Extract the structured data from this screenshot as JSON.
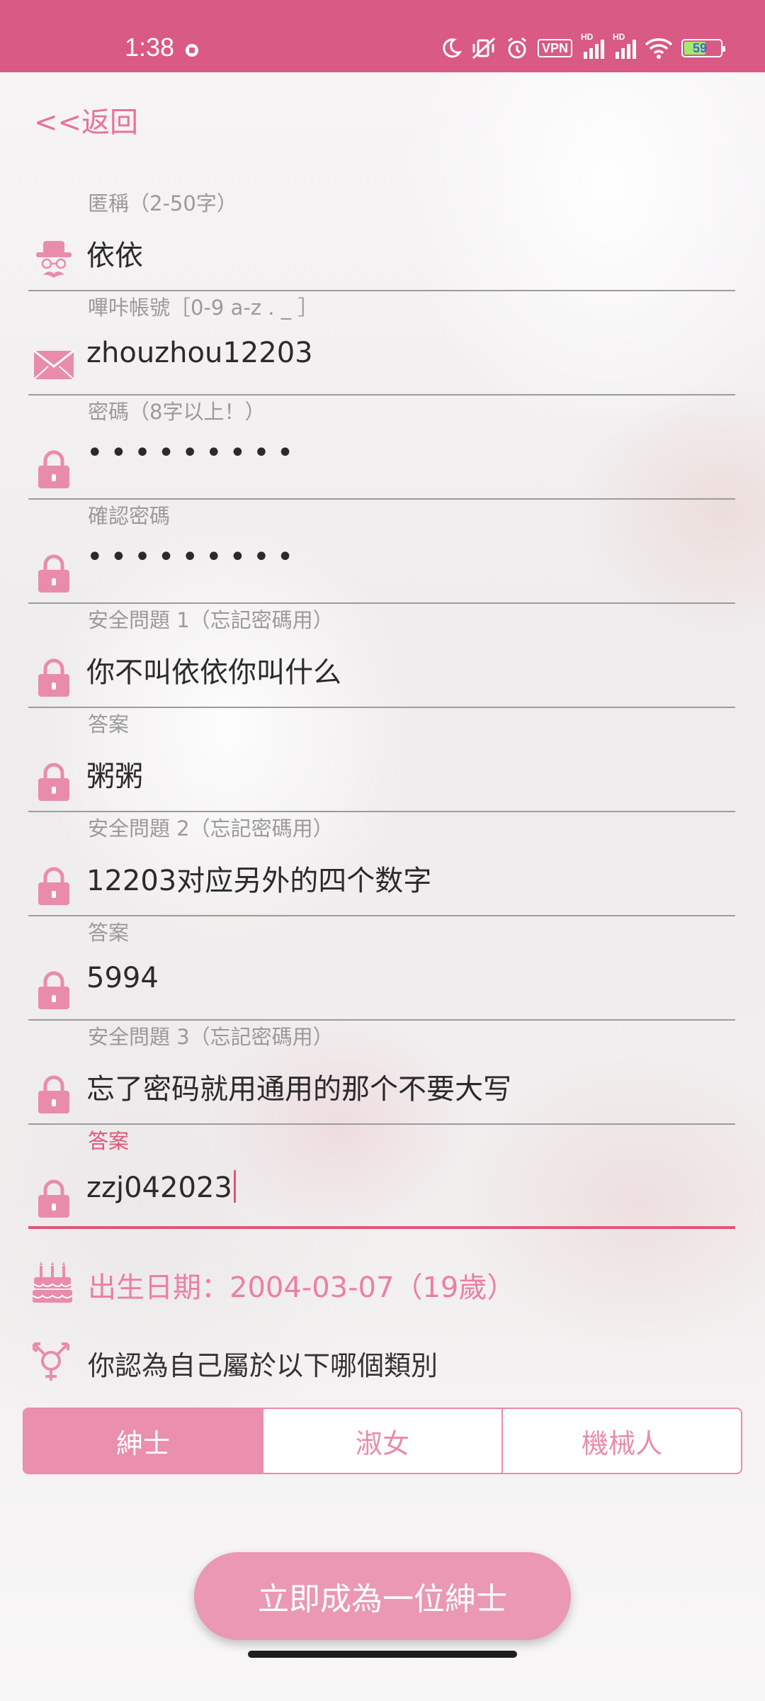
{
  "status_bar": {
    "time": "1:38",
    "vpn_label": "VPN",
    "hd_label": "HD",
    "battery_level": "59"
  },
  "nav": {
    "back_label": "<<返回"
  },
  "form": {
    "fields": [
      {
        "label": "匿稱（2-50字）",
        "value": "依依",
        "icon": "gentleman-icon"
      },
      {
        "label": "嗶咔帳號［0-9 a-z . _ ］",
        "value": "zhouzhou12203",
        "icon": "envelope-icon"
      },
      {
        "label": "密碼（8字以上！）",
        "value": "•••••••••",
        "icon": "lock-icon"
      },
      {
        "label": "確認密碼",
        "value": "•••••••••",
        "icon": "lock-icon"
      },
      {
        "label": "安全問題 1（忘記密碼用）",
        "value": "你不叫依依你叫什么",
        "icon": "lock-icon"
      },
      {
        "label": "答案",
        "value": "粥粥",
        "icon": "lock-icon"
      },
      {
        "label": "安全問題 2（忘記密碼用）",
        "value": "12203对应另外的四个数字",
        "icon": "lock-icon"
      },
      {
        "label": "答案",
        "value": "5994",
        "icon": "lock-icon"
      },
      {
        "label": "安全問題 3（忘記密碼用）",
        "value": "忘了密码就用通用的那个不要大写",
        "icon": "lock-icon"
      },
      {
        "label": "答案",
        "value": "zzj042023",
        "icon": "lock-icon",
        "focused": true
      }
    ],
    "birthday": "出生日期：2004-03-07（19歲）",
    "gender_question": "你認為自己屬於以下哪個類別",
    "gender_options": [
      "紳士",
      "淑女",
      "機械人"
    ],
    "gender_selected": "紳士",
    "submit_label": "立即成為一位紳士"
  },
  "colors": {
    "status_bar": "#d95a84",
    "accent": "#e98cab",
    "focus": "#e4547a",
    "button": "#ea98b4"
  }
}
